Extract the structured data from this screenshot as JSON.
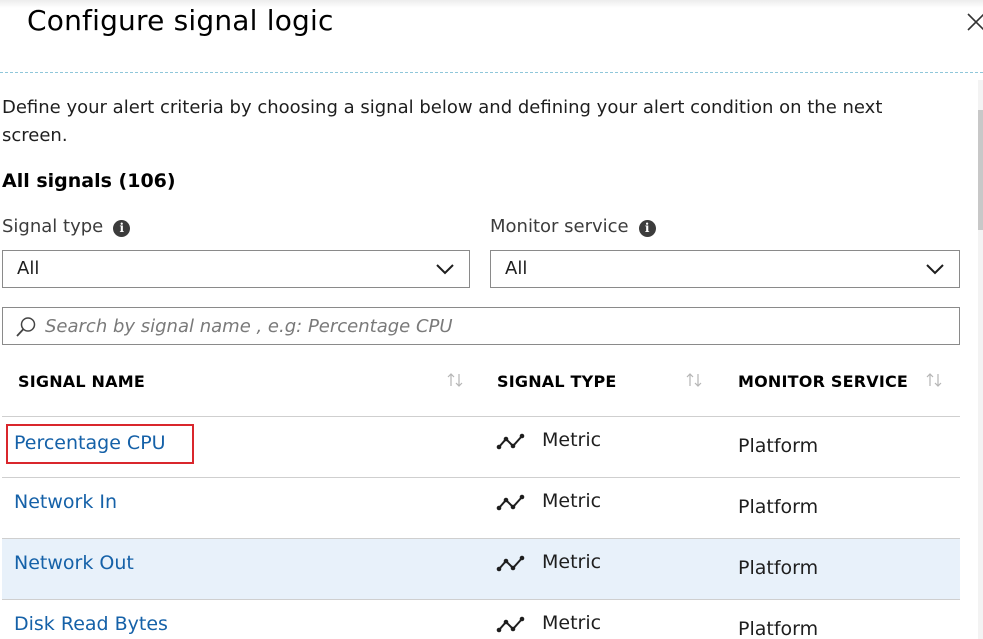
{
  "panel": {
    "title": "Configure signal logic",
    "description": "Define your alert criteria by choosing a signal below and defining your alert condition on the next screen.",
    "section_title": "All signals (106)"
  },
  "filters": {
    "signal_type": {
      "label": "Signal type",
      "value": "All"
    },
    "monitor_service": {
      "label": "Monitor service",
      "value": "All"
    }
  },
  "search": {
    "placeholder": "Search by signal name , e.g: Percentage CPU",
    "value": ""
  },
  "table": {
    "columns": [
      "SIGNAL NAME",
      "SIGNAL TYPE",
      "MONITOR SERVICE"
    ],
    "rows": [
      {
        "name": "Percentage CPU",
        "type": "Metric",
        "service": "Platform"
      },
      {
        "name": "Network In",
        "type": "Metric",
        "service": "Platform"
      },
      {
        "name": "Network Out",
        "type": "Metric",
        "service": "Platform"
      },
      {
        "name": "Disk Read Bytes",
        "type": "Metric",
        "service": "Platform"
      }
    ]
  },
  "icons": {
    "close": "close-icon",
    "info": "info-icon",
    "dropdown": "chevron-down-icon",
    "search": "search-icon",
    "sort": "sort-icon",
    "metric": "metric-icon"
  },
  "colors": {
    "link": "#1561a8",
    "selected_row": "#e8f1fa",
    "highlight_border": "#d9262c",
    "divider": "#8fc7da"
  }
}
